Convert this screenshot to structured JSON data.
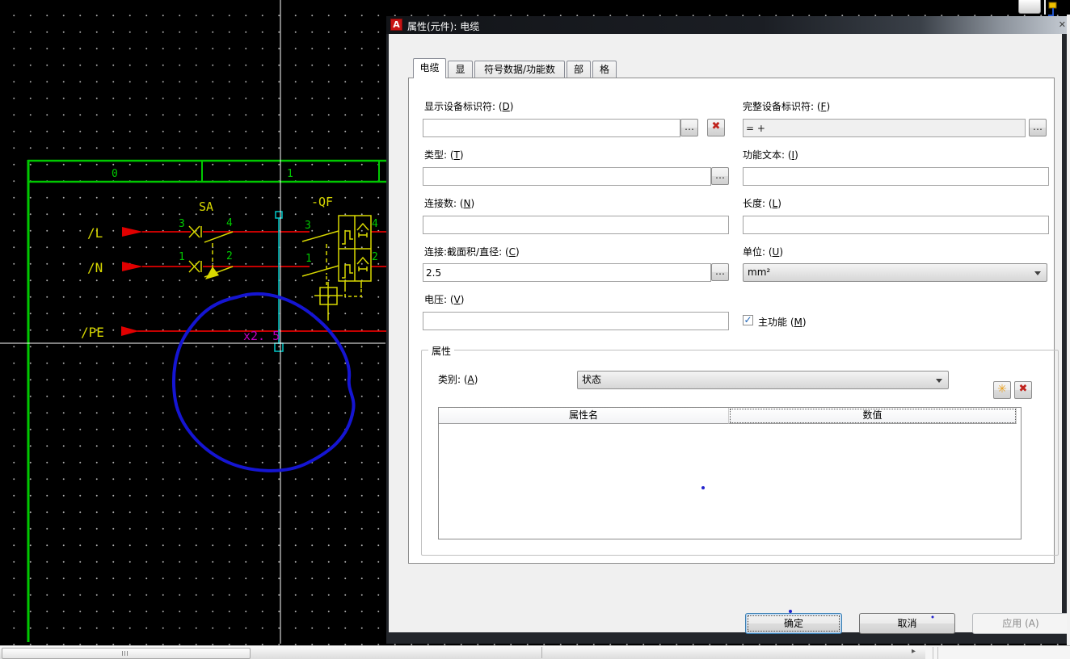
{
  "window": {
    "title": "属性(元件): 电缆",
    "close_glyph": "✕",
    "logo_glyph": "A"
  },
  "tabs": [
    {
      "label": "电缆",
      "active": true
    },
    {
      "label": "显示",
      "active": false
    },
    {
      "label": "符号数据/功能数据",
      "active": false
    },
    {
      "label": "部件",
      "active": false
    },
    {
      "label": "格式",
      "active": false
    }
  ],
  "fields": {
    "display_dt": {
      "label": "显示设备标识符: (D)",
      "value": ""
    },
    "full_dt": {
      "label": "完整设备标识符: (F)",
      "value": "= +"
    },
    "type": {
      "label": "类型: (T)",
      "value": ""
    },
    "function_text": {
      "label": "功能文本: (I)",
      "value": ""
    },
    "conn_count": {
      "label": "连接数: (N)",
      "value": ""
    },
    "length": {
      "label": "长度: (L)",
      "value": ""
    },
    "cross_section": {
      "label": "连接:截面积/直径: (C)",
      "value": "2.5"
    },
    "unit": {
      "label": "单位: (U)",
      "value": "mm²"
    },
    "voltage": {
      "label": "电压: (V)",
      "value": ""
    },
    "main_function": {
      "label": "主功能 (M)",
      "checked": true
    }
  },
  "icons": {
    "browse": "…",
    "delete": "✖",
    "new": "✳",
    "check": "✓",
    "scroll_right": "▸"
  },
  "attributes_group": {
    "legend": "属性",
    "category_label": "类别: (A)",
    "category_value": "状态",
    "table_headers": [
      "属性名",
      "数值"
    ],
    "rows": []
  },
  "footer_buttons": {
    "ok": "确定",
    "cancel": "取消",
    "apply": "应用 (A)"
  },
  "cad": {
    "column_labels": [
      "0",
      "1"
    ],
    "wire_labels": [
      "/L",
      "/N",
      "/PE"
    ],
    "switch_label": "SA",
    "breaker_label": "-QF",
    "cursor_text": "x2. 5",
    "sa_terminals": [
      "3",
      "4",
      "1",
      "2"
    ],
    "qf_terminals": [
      "3",
      "4",
      "1",
      "2"
    ],
    "colors": {
      "frame_green": "#00c800",
      "wire_red": "#e10000",
      "symbol_yellow": "#d8d800",
      "cable_cyan": "#00c8c8",
      "crosshair_white": "#ffffff",
      "annotation_blue": "#1515d2",
      "text_magenta": "#c000c0"
    }
  }
}
